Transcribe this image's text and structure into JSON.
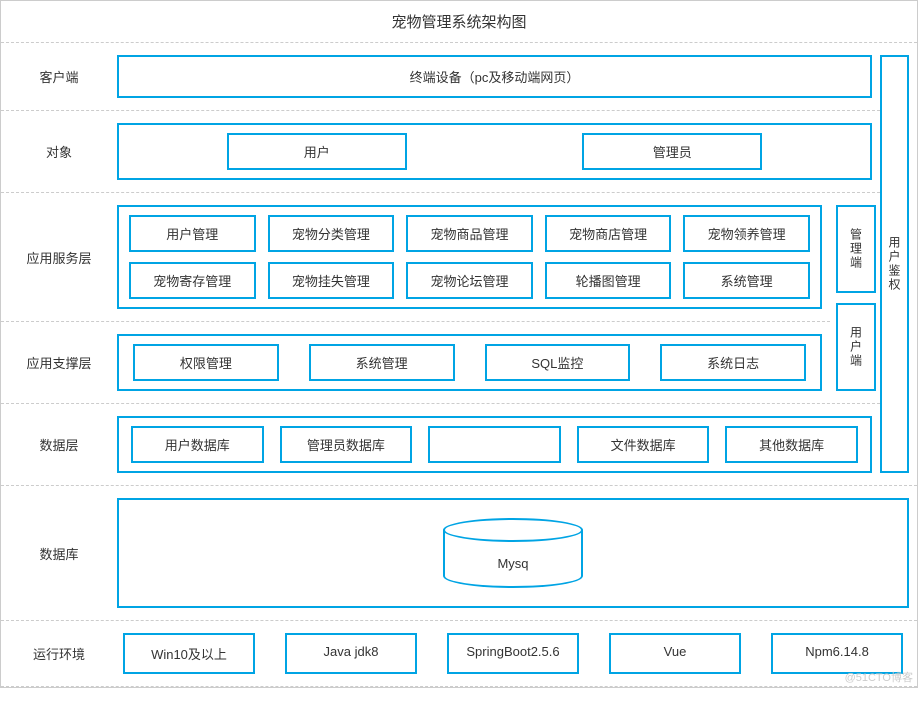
{
  "title": "宠物管理系统架构图",
  "labels": {
    "client": "客户端",
    "object": "对象",
    "app_service": "应用服务层",
    "app_support": "应用支撑层",
    "data_layer": "数据层",
    "database": "数据库",
    "runtime": "运行环境"
  },
  "client": {
    "terminal": "终端设备（pc及移动端网页）"
  },
  "object": {
    "items": [
      "用户",
      "管理员"
    ]
  },
  "app_service": {
    "row1": [
      "用户管理",
      "宠物分类管理",
      "宠物商品管理",
      "宠物商店管理",
      "宠物领养管理"
    ],
    "row2": [
      "宠物寄存管理",
      "宠物挂失管理",
      "宠物论坛管理",
      "轮播图管理",
      "系统管理"
    ]
  },
  "side": {
    "admin": "管理端",
    "user": "用户端",
    "auth": "用户鉴权"
  },
  "app_support": {
    "items": [
      "权限管理",
      "系统管理",
      "SQL监控",
      "系统日志"
    ]
  },
  "data_layer": {
    "items": [
      "用户数据库",
      "管理员数据库",
      "",
      "文件数据库",
      "其他数据库"
    ]
  },
  "database": {
    "name": "Mysq"
  },
  "runtime": {
    "items": [
      "Win10及以上",
      "Java jdk8",
      "SpringBoot2.5.6",
      "Vue",
      "Npm6.14.8"
    ]
  },
  "watermark": "@51CTO博客"
}
